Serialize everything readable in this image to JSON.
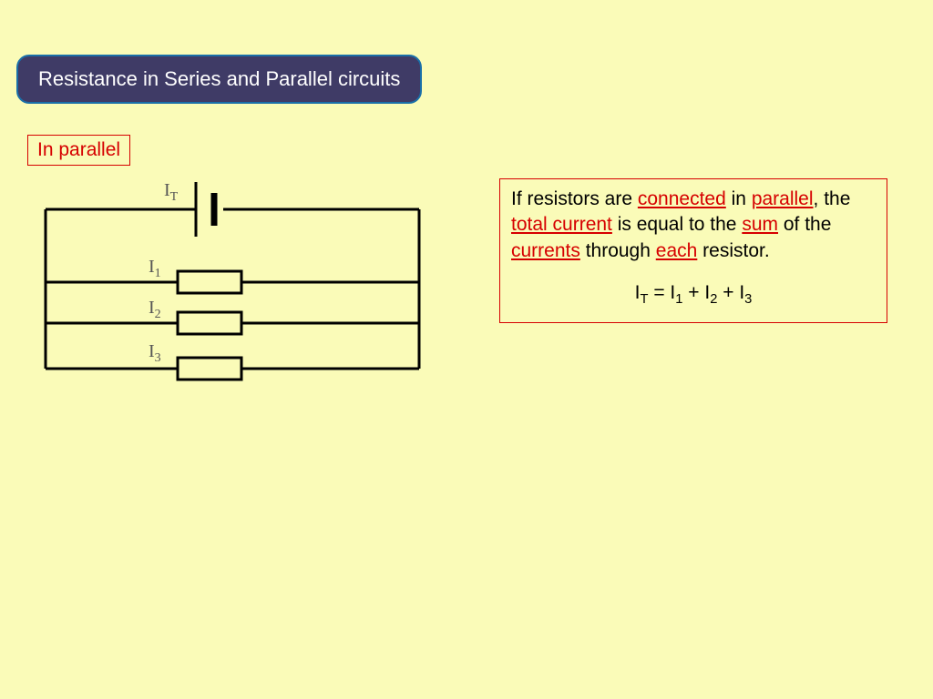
{
  "title": "Resistance in Series and Parallel circuits",
  "subtitle": "In parallel",
  "labels": {
    "IT": "I",
    "IT_sub": "T",
    "I1": "I",
    "I1_sub": "1",
    "I2": "I",
    "I2_sub": "2",
    "I3": "I",
    "I3_sub": "3"
  },
  "description": {
    "t1": "If resistors are ",
    "k1": "connected",
    "t2": " in ",
    "k2": "parallel",
    "t3": ", the ",
    "k3": "total current",
    "t4": " is equal to the ",
    "k4": "sum",
    "t5": " of the ",
    "k5": "currents",
    "t6": " through ",
    "k6": "each",
    "t7": " resistor."
  },
  "formula": {
    "lhs": "I",
    "lhs_sub": "T",
    "eq": "  =  ",
    "r1": "I",
    "r1_sub": "1",
    "plus1": " + ",
    "r2": "I",
    "r2_sub": "2",
    "plus2": " + ",
    "r3": "I",
    "r3_sub": "3"
  }
}
